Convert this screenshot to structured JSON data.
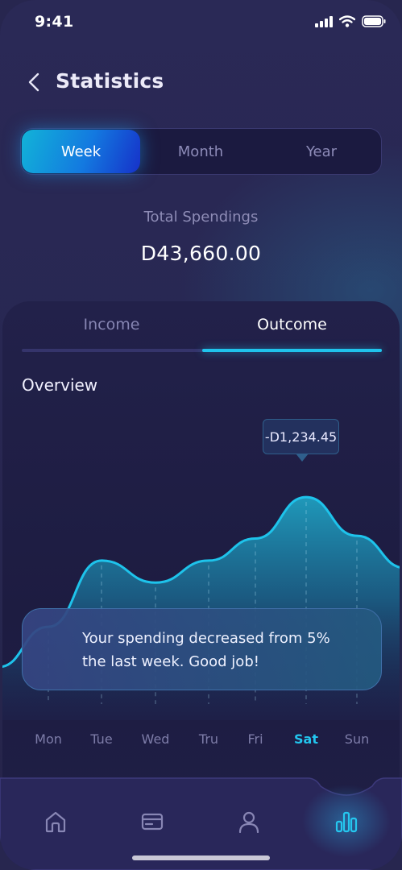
{
  "status_bar": {
    "time": "9:41",
    "icons": [
      "signal-icon",
      "wifi-icon",
      "battery-icon"
    ]
  },
  "header": {
    "back_icon": "chevron-left-icon",
    "title": "Statistics"
  },
  "period_tabs": {
    "items": [
      {
        "label": "Week",
        "active": true
      },
      {
        "label": "Month",
        "active": false
      },
      {
        "label": "Year",
        "active": false
      }
    ]
  },
  "summary": {
    "label": "Total Spendings",
    "value": "D43,660.00"
  },
  "card": {
    "tabs": [
      {
        "label": "Income",
        "active": false
      },
      {
        "label": "Outcome",
        "active": true
      }
    ],
    "section_title": "Overview",
    "tooltip": "-D1,234.45",
    "notice": "Your spending decreased from 5% the last week. Good job!"
  },
  "chart_data": {
    "type": "area",
    "categories": [
      "Mon",
      "Tue",
      "Wed",
      "Tru",
      "Fri",
      "Sat",
      "Sun"
    ],
    "series": [
      {
        "values": [
          28,
          52,
          44,
          52,
          60,
          75,
          61
        ]
      }
    ],
    "highlighted_category": "Sat",
    "highlighted_label": "-D1,234.45",
    "axes_visible": false,
    "grid": false,
    "colors": {
      "line": "#1ec3eb",
      "fill": "#1e8fb0"
    }
  },
  "bottom_nav": {
    "items": [
      {
        "icon": "home-icon",
        "active": false
      },
      {
        "icon": "card-icon",
        "active": false
      },
      {
        "icon": "profile-icon",
        "active": false
      },
      {
        "icon": "bar-chart-icon",
        "active": true
      }
    ]
  },
  "colors": {
    "background": "#27264f",
    "accent": "#1fc4ec",
    "active_segment_start": "#12b3d8",
    "active_segment_end": "#1631c9",
    "muted_text": "#8e8cb6"
  }
}
